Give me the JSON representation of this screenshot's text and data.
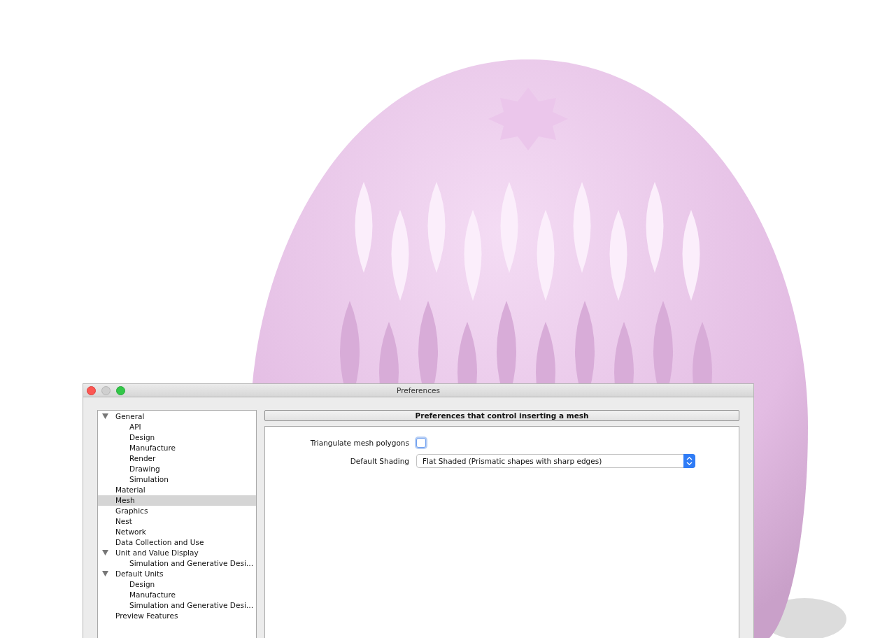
{
  "window": {
    "title": "Preferences"
  },
  "tree": [
    {
      "label": "General",
      "expanded": true,
      "selected": false,
      "children": [
        {
          "label": "API",
          "selected": false
        },
        {
          "label": "Design",
          "selected": false
        },
        {
          "label": "Manufacture",
          "selected": false
        },
        {
          "label": "Render",
          "selected": false
        },
        {
          "label": "Drawing",
          "selected": false
        },
        {
          "label": "Simulation",
          "selected": false
        }
      ]
    },
    {
      "label": "Material",
      "selected": false
    },
    {
      "label": "Mesh",
      "selected": true
    },
    {
      "label": "Graphics",
      "selected": false
    },
    {
      "label": "Nest",
      "selected": false
    },
    {
      "label": "Network",
      "selected": false
    },
    {
      "label": "Data Collection and Use",
      "selected": false
    },
    {
      "label": "Unit and Value Display",
      "expanded": true,
      "selected": false,
      "children": [
        {
          "label": "Simulation and Generative Desi…",
          "selected": false
        }
      ]
    },
    {
      "label": "Default Units",
      "expanded": true,
      "selected": false,
      "children": [
        {
          "label": "Design",
          "selected": false
        },
        {
          "label": "Manufacture",
          "selected": false
        },
        {
          "label": "Simulation and Generative Desi…",
          "selected": false
        }
      ]
    },
    {
      "label": "Preview Features",
      "selected": false
    }
  ],
  "panel": {
    "heading": "Preferences that control inserting a mesh",
    "fields": [
      {
        "kind": "checkbox",
        "label": "Triangulate mesh polygons",
        "checked": false
      },
      {
        "kind": "select",
        "label": "Default Shading",
        "value": "Flat Shaded (Prismatic shapes with sharp edges)"
      }
    ]
  }
}
